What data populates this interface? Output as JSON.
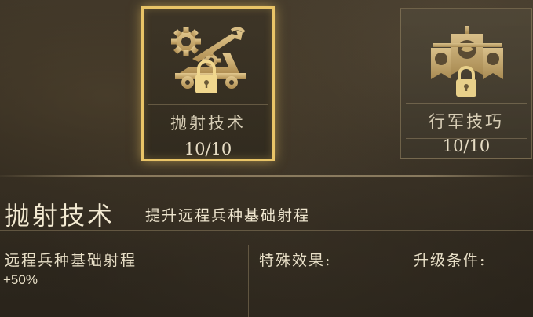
{
  "skills": [
    {
      "name": "抛射技术",
      "level": "10/10",
      "icon": "catapult-gears-icon",
      "locked": true,
      "selected": true
    },
    {
      "name": "行军技巧",
      "level": "10/10",
      "icon": "war-banners-icon",
      "locked": true,
      "selected": false
    }
  ],
  "detail": {
    "title": "抛射技术",
    "description": "提升远程兵种基础射程",
    "effect_name": "远程兵种基础射程",
    "effect_value": "+50%",
    "special_label": "特殊效果:",
    "upgrade_label": "升级条件:"
  },
  "colors": {
    "gold_highlight": "#e9c467",
    "icon_gold": "#c9a968"
  }
}
